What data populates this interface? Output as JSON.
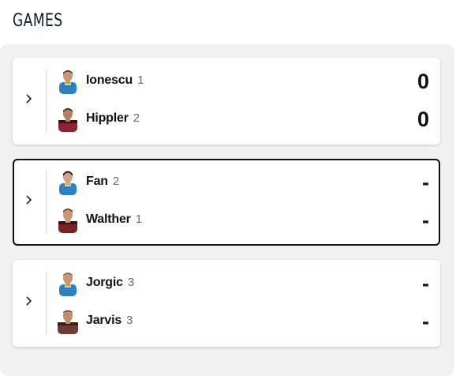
{
  "header": {
    "title": "GAMES"
  },
  "games": [
    {
      "players": [
        {
          "name": "Ionescu",
          "seed": "1",
          "score": "0",
          "kit": "blue"
        },
        {
          "name": "Hippler",
          "seed": "2",
          "score": "0",
          "kit": "red"
        }
      ]
    },
    {
      "players": [
        {
          "name": "Fan",
          "seed": "2",
          "score": "-",
          "kit": "blue"
        },
        {
          "name": "Walther",
          "seed": "1",
          "score": "-",
          "kit": "red"
        }
      ]
    },
    {
      "players": [
        {
          "name": "Jorgic",
          "seed": "3",
          "score": "-",
          "kit": "blue"
        },
        {
          "name": "Jarvis",
          "seed": "3",
          "score": "-",
          "kit": "red"
        }
      ]
    }
  ],
  "colors": {
    "kit_blue": "#2f7fc4",
    "kit_red": "#8a2430",
    "skin": "#c99775",
    "hair": "#3a2a20",
    "active_border": "#111111"
  },
  "icons": {
    "expand": "chevron-right-icon",
    "avatar": "player-avatar-icon"
  }
}
